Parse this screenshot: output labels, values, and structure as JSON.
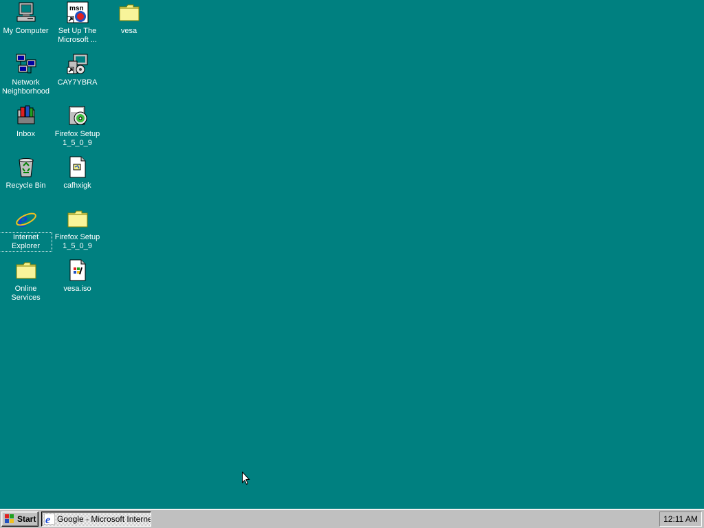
{
  "desktop": {
    "background_color": "#008080",
    "icons": [
      {
        "label": "My Computer",
        "icon": "my-computer-icon"
      },
      {
        "label": "Set Up The\nMicrosoft ...",
        "icon": "msn-icon"
      },
      {
        "label": "vesa",
        "icon": "folder-icon"
      },
      {
        "label": "Network\nNeighborhood",
        "icon": "network-neighborhood-icon"
      },
      {
        "label": "CAY7YBRA",
        "icon": "computer-disc-icon"
      },
      {
        "label": "Inbox",
        "icon": "inbox-icon"
      },
      {
        "label": "Firefox Setup\n1_5_0_9",
        "icon": "setup-cd-icon"
      },
      {
        "label": "Recycle Bin",
        "icon": "recycle-bin-icon"
      },
      {
        "label": "cafhxigk",
        "icon": "document-icon"
      },
      {
        "label": "Internet\nExplorer",
        "icon": "internet-explorer-icon"
      },
      {
        "label": "Firefox Setup\n1_5_0_9",
        "icon": "folder-icon"
      },
      {
        "label": "Online\nServices",
        "icon": "folder-icon"
      },
      {
        "label": "vesa.iso",
        "icon": "iso-file-icon"
      }
    ]
  },
  "taskbar": {
    "start_label": "Start",
    "tasks": [
      {
        "label": "Google - Microsoft Internet...",
        "icon": "internet-explorer-icon"
      }
    ],
    "clock": "12:11 AM"
  }
}
